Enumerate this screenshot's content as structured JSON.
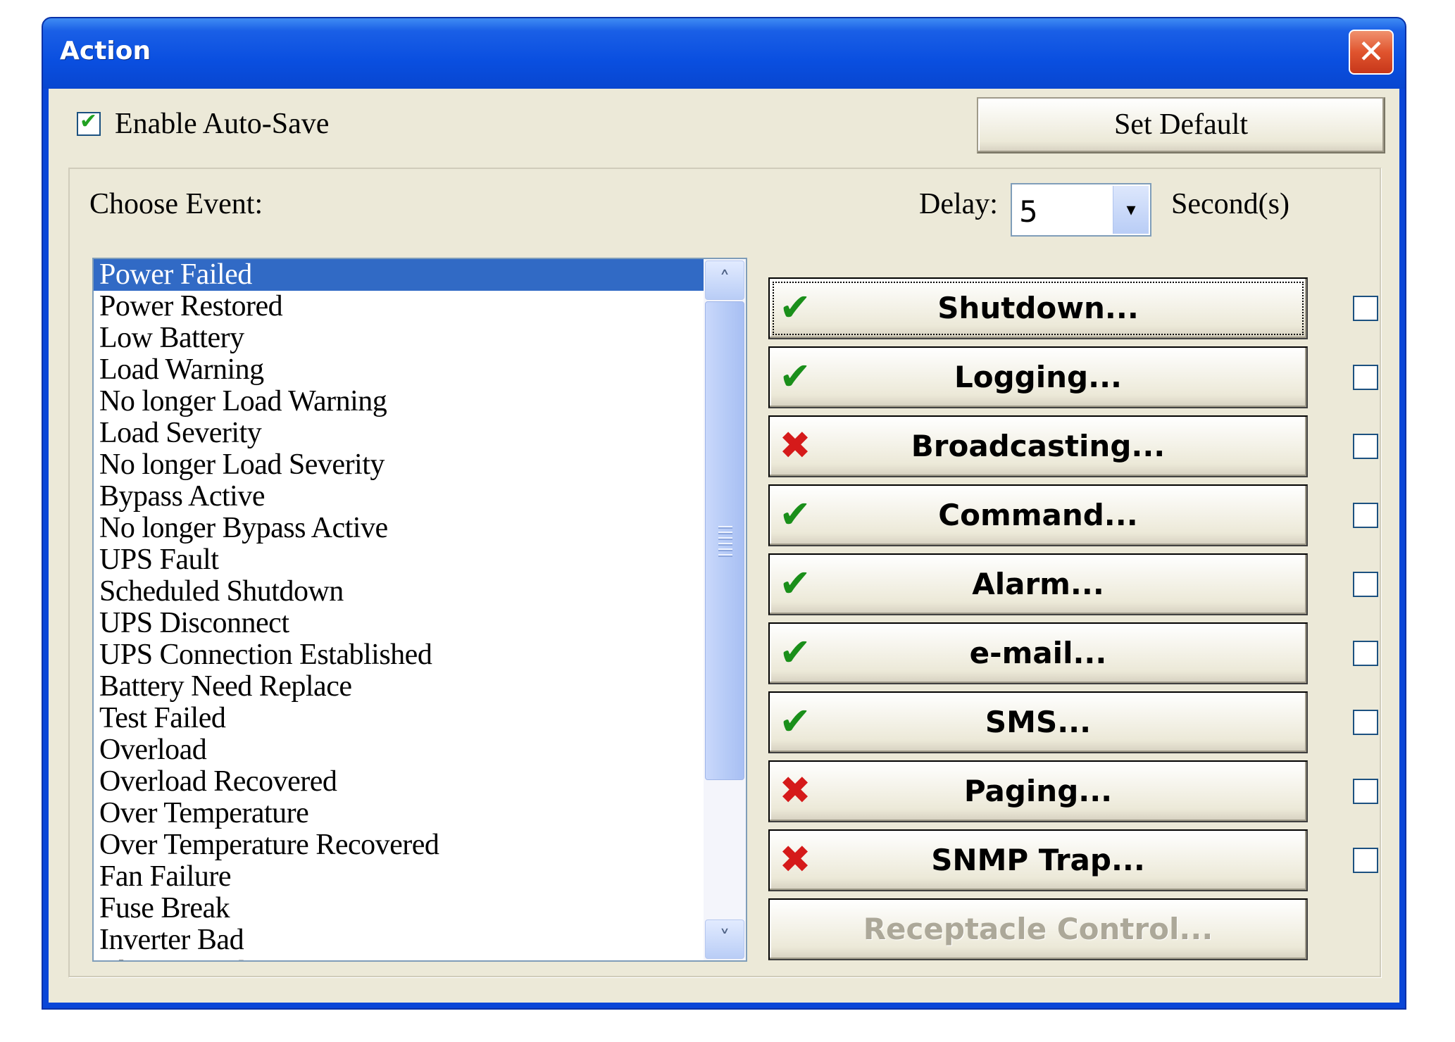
{
  "window": {
    "title": "Action",
    "close_glyph": "✕"
  },
  "auto_save": {
    "label": "Enable Auto-Save",
    "checked": true
  },
  "set_default_label": "Set Default",
  "choose_event_label": "Choose Event:",
  "delay": {
    "label": "Delay:",
    "value": "5",
    "unit_label": "Second(s)",
    "arrow_glyph": "▾"
  },
  "events": [
    {
      "label": "Power Failed",
      "selected": true
    },
    {
      "label": "Power Restored"
    },
    {
      "label": "Low Battery"
    },
    {
      "label": "Load Warning"
    },
    {
      "label": "No longer Load Warning"
    },
    {
      "label": "Load Severity"
    },
    {
      "label": "No longer Load Severity"
    },
    {
      "label": "Bypass Active"
    },
    {
      "label": "No longer Bypass Active"
    },
    {
      "label": "UPS Fault"
    },
    {
      "label": "Scheduled Shutdown"
    },
    {
      "label": "UPS Disconnect"
    },
    {
      "label": "UPS Connection Established"
    },
    {
      "label": "Battery Need Replace"
    },
    {
      "label": "Test Failed"
    },
    {
      "label": "Overload"
    },
    {
      "label": "Overload Recovered"
    },
    {
      "label": "Over Temperature"
    },
    {
      "label": "Over Temperature Recovered"
    },
    {
      "label": "Fan Failure"
    },
    {
      "label": "Fuse Break"
    },
    {
      "label": "Inverter Bad"
    },
    {
      "label": "Charger Bad"
    }
  ],
  "scroll": {
    "up_glyph": "˄",
    "down_glyph": "˅"
  },
  "actions": [
    {
      "label": "Shutdown...",
      "status": "enabled",
      "status_glyph": "✔",
      "checked": false,
      "focused": true
    },
    {
      "label": "Logging...",
      "status": "enabled",
      "status_glyph": "✔",
      "checked": false
    },
    {
      "label": "Broadcasting...",
      "status": "disabled",
      "status_glyph": "✖",
      "checked": false
    },
    {
      "label": "Command...",
      "status": "enabled",
      "status_glyph": "✔",
      "checked": false
    },
    {
      "label": "Alarm...",
      "status": "enabled",
      "status_glyph": "✔",
      "checked": false
    },
    {
      "label": "e-mail...",
      "status": "enabled",
      "status_glyph": "✔",
      "checked": false
    },
    {
      "label": "SMS...",
      "status": "enabled",
      "status_glyph": "✔",
      "checked": false
    },
    {
      "label": "Paging...",
      "status": "disabled",
      "status_glyph": "✖",
      "checked": false
    },
    {
      "label": "SNMP Trap...",
      "status": "disabled",
      "status_glyph": "✖",
      "checked": false
    },
    {
      "label": "Receptacle Control...",
      "greyed": true
    }
  ],
  "colors": {
    "titlebar": "#0a4fe0",
    "selection": "#316ac5",
    "ok": "#1a8f1a",
    "bad": "#d51a1a",
    "face": "#ece9d8"
  }
}
